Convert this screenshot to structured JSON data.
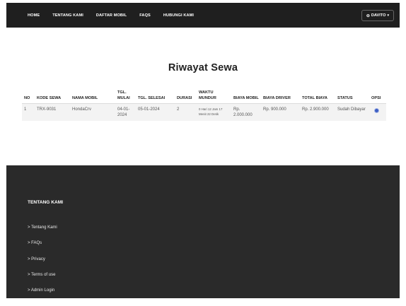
{
  "nav": {
    "links": [
      "HOME",
      "TENTANG KAMI",
      "DAFTAR MOBIL",
      "FAQS",
      "HUBUNGI KAMI"
    ],
    "user": "DAVITO"
  },
  "page": {
    "title": "Riwayat Sewa"
  },
  "table": {
    "headers": [
      "NO",
      "KODE SEWA",
      "NAMA MOBIL",
      "TGL. MULAI",
      "TGL. SELESAI",
      "DURASI",
      "WAKTU MUNDUR",
      "BIAYA MOBIL",
      "BIAYA DRIVER",
      "TOTAL BIAYA",
      "STATUS",
      "OPSI"
    ],
    "rows": [
      {
        "no": "1",
        "kode": "TRX-9031",
        "mobil": "HondaCrv",
        "mulai": "04-01-2024",
        "selesai": "05-01-2024",
        "durasi": "2",
        "waktu": "0 Hari 12 Jam 17 Menit 22 Detik",
        "biaya_mobil": "Rp. 2.000.000",
        "biaya_driver": "Rp. 900.000",
        "total": "Rp. 2.900.000",
        "status": "Sudah Dibayar",
        "opsi_icon": "eye-icon"
      }
    ]
  },
  "footer": {
    "title": "TENTANG KAMI",
    "links": [
      "Tentang Kami",
      "FAQs",
      "Privacy",
      "Terms of use",
      "Admin Login"
    ]
  },
  "colors": {
    "nav_bg": "#1f1f1f",
    "footer_bg": "#2a2a2a",
    "accent": "#3d5fc4"
  }
}
